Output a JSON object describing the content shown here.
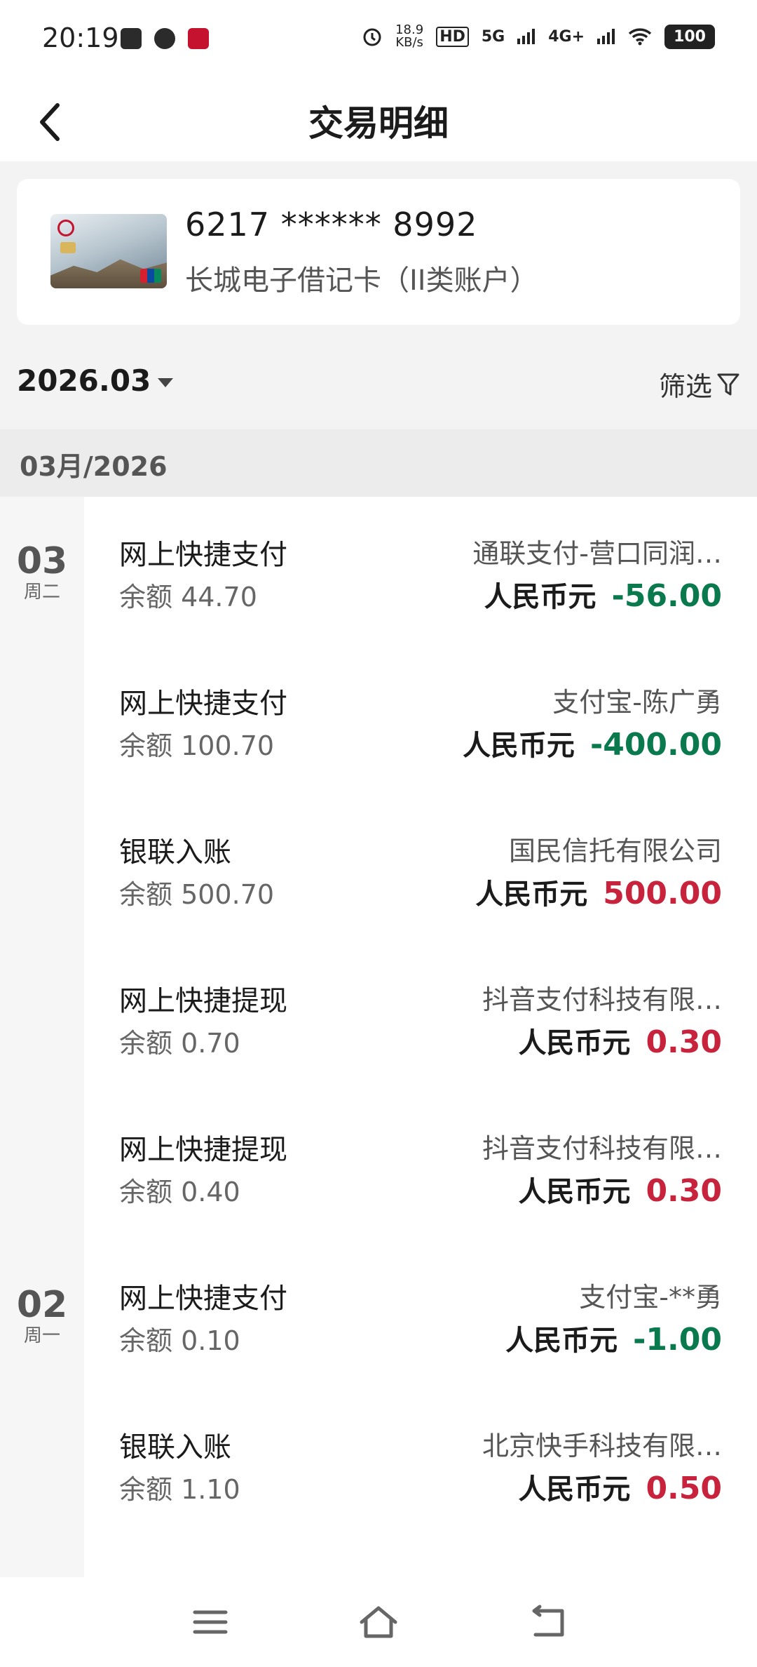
{
  "status_bar": {
    "time": "20:19",
    "net_speed_value": "18.9",
    "net_speed_unit": "KB/s",
    "hd_label": "HD",
    "signal_1": "5G",
    "signal_2": "4G+",
    "battery": "100"
  },
  "header": {
    "title": "交易明细"
  },
  "card": {
    "number": "6217 ****** 8992",
    "name": "长城电子借记卡（II类账户）"
  },
  "filter_bar": {
    "month": "2026.03",
    "filter_label": "筛选"
  },
  "section": {
    "label": "03月/2026"
  },
  "dates": [
    {
      "day": "03",
      "weekday": "周二"
    },
    {
      "day": "02",
      "weekday": "周一"
    }
  ],
  "transactions": [
    {
      "type": "网上快捷支付",
      "balance": "余额 44.70",
      "counterparty": "通联支付-营口同润…",
      "currency": "人民币元",
      "amount": "-56.00",
      "direction": "out"
    },
    {
      "type": "网上快捷支付",
      "balance": "余额 100.70",
      "counterparty": "支付宝-陈广勇",
      "currency": "人民币元",
      "amount": "-400.00",
      "direction": "out"
    },
    {
      "type": "银联入账",
      "balance": "余额 500.70",
      "counterparty": "国民信托有限公司",
      "currency": "人民币元",
      "amount": "500.00",
      "direction": "in"
    },
    {
      "type": "网上快捷提现",
      "balance": "余额 0.70",
      "counterparty": "抖音支付科技有限…",
      "currency": "人民币元",
      "amount": "0.30",
      "direction": "in"
    },
    {
      "type": "网上快捷提现",
      "balance": "余额 0.40",
      "counterparty": "抖音支付科技有限…",
      "currency": "人民币元",
      "amount": "0.30",
      "direction": "in"
    },
    {
      "type": "网上快捷支付",
      "balance": "余额 0.10",
      "counterparty": "支付宝-**勇",
      "currency": "人民币元",
      "amount": "-1.00",
      "direction": "out"
    },
    {
      "type": "银联入账",
      "balance": "余额 1.10",
      "counterparty": "北京快手科技有限…",
      "currency": "人民币元",
      "amount": "0.50",
      "direction": "in"
    }
  ],
  "colors": {
    "expense": "#0a7a4e",
    "income": "#c8233d"
  },
  "icons": {
    "back": "chevron-left-icon",
    "filter": "funnel-icon",
    "month_dropdown": "caret-down-icon",
    "nav_menu": "menu-icon",
    "nav_home": "home-icon",
    "nav_back": "return-icon"
  }
}
